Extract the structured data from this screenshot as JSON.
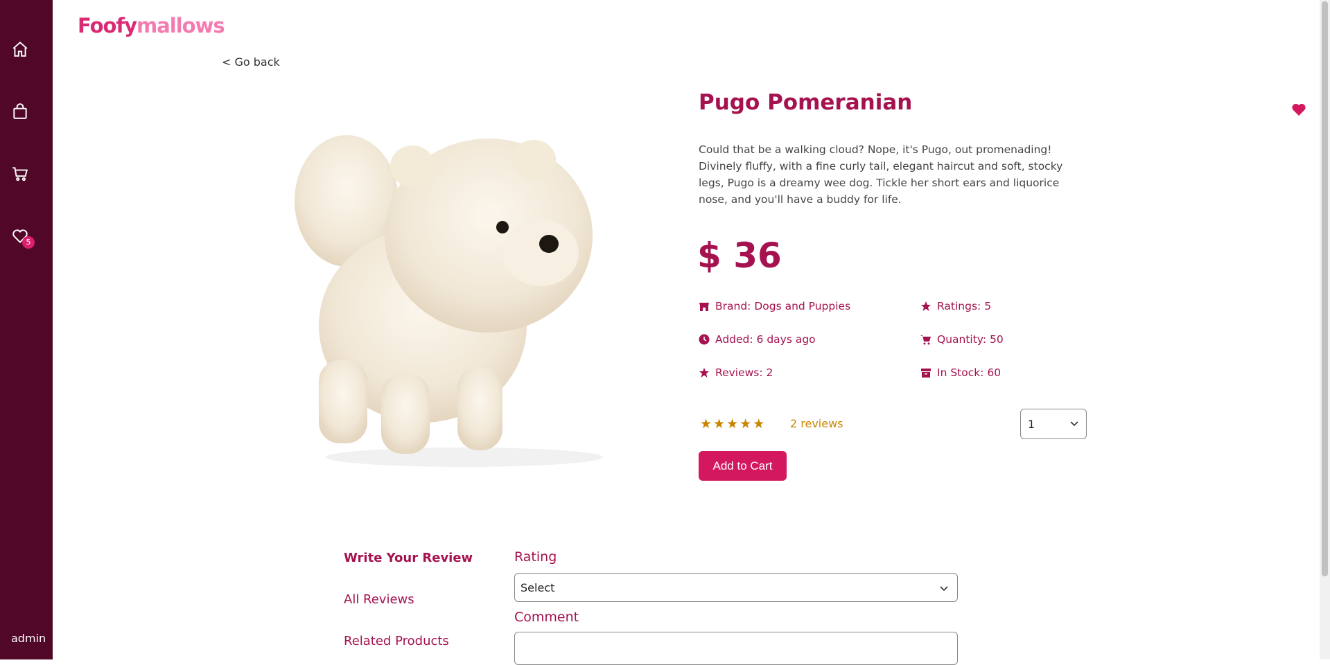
{
  "logo": {
    "part1": "Foofy",
    "part2": "mallows"
  },
  "sidebar": {
    "icons": [
      "home-icon",
      "shopping-bag-icon",
      "cart-icon",
      "heart-icon"
    ],
    "wishlist_count": "5",
    "user": "admin"
  },
  "nav": {
    "go_back": "< Go back"
  },
  "product": {
    "title": "Pugo Pomeranian",
    "description": "Could that be a walking cloud? Nope, it's Pugo, out promenading! Divinely fluffy, with a fine curly tail, elegant haircut and soft, stocky legs, Pugo is a dreamy wee dog. Tickle her short ears and liquorice nose, and you'll have a buddy for life.",
    "price": "$ 36",
    "brand": "Brand: Dogs and Puppies",
    "added": "Added: 6 days ago",
    "reviews": "Reviews: 2",
    "ratings": "Ratings: 5",
    "quantity": "Quantity: 50",
    "in_stock": "In Stock: 60",
    "star_rating": 5,
    "reviews_link": "2 reviews",
    "qty_selected": "1",
    "add_to_cart": "Add to Cart"
  },
  "tabs": {
    "write_review": "Write Your Review",
    "all_reviews": "All Reviews",
    "related_products": "Related Products"
  },
  "review_form": {
    "rating_label": "Rating",
    "rating_selected": "Select",
    "comment_label": "Comment",
    "comment_value": ""
  },
  "colors": {
    "sidebar": "#510728",
    "accent": "#a5124f",
    "button": "#d4185f",
    "star": "#c98500"
  }
}
